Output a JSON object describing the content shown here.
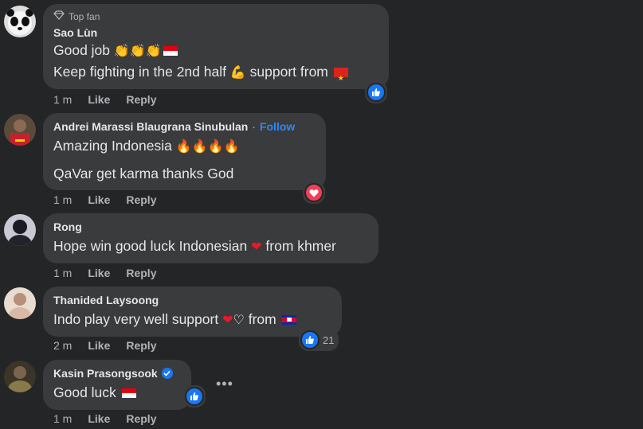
{
  "colors": {
    "bg": "#242526",
    "bubble": "#3a3b3c",
    "text": "#e4e6eb",
    "muted": "#b0b3b8",
    "link": "#2d88ff",
    "like": "#1877f2",
    "love": "#f33e58"
  },
  "comments": [
    {
      "badge": "Top fan",
      "author": "Sao Lùn",
      "lines": [
        "Good job",
        "Keep fighting in the 2nd half",
        "support from"
      ],
      "time": "1 m",
      "like": "Like",
      "reply": "Reply",
      "reaction": "like-icon"
    },
    {
      "author": "Andrei Marassi Blaugrana Sinubulan",
      "separator": "·",
      "follow": "Follow",
      "lines": [
        "Amazing Indonesia",
        "QaVar get karma thanks God"
      ],
      "time": "1 m",
      "like": "Like",
      "reply": "Reply",
      "reaction": "heart-icon"
    },
    {
      "author": "Rong",
      "lines": [
        "Hope win good luck Indonesian",
        "from khmer"
      ],
      "time": "1 m",
      "like": "Like",
      "reply": "Reply"
    },
    {
      "author": "Thanided Laysoong",
      "lines": [
        "Indo play very well support",
        "from"
      ],
      "time": "2 m",
      "like": "Like",
      "reply": "Reply",
      "reaction": "like-icon",
      "reaction_count": "21"
    },
    {
      "author": "Kasin Prasongsook",
      "verified": true,
      "lines": [
        "Good luck"
      ],
      "time": "1 m",
      "like": "Like",
      "reply": "Reply",
      "reaction": "like-icon",
      "more": "•••"
    }
  ]
}
